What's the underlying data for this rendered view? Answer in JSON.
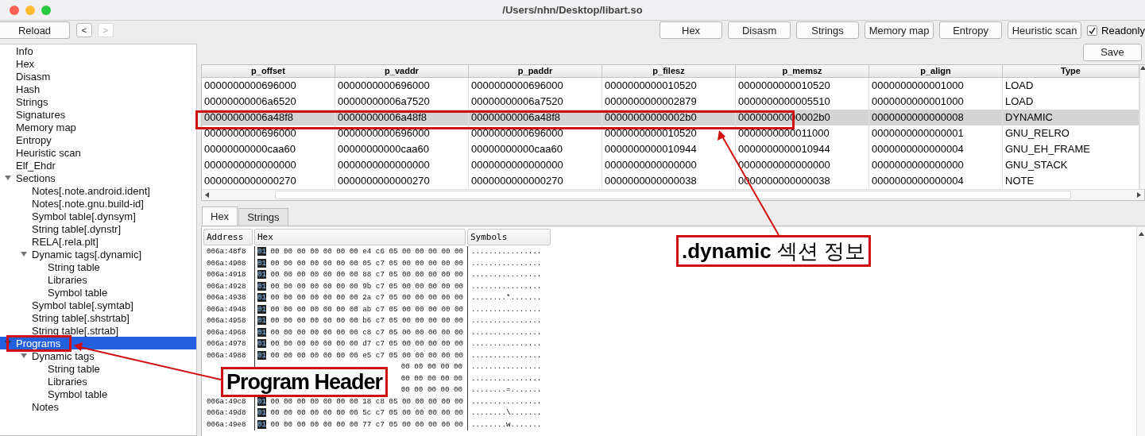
{
  "window": {
    "title": "/Users/nhn/Desktop/libart.so"
  },
  "toolbar": {
    "reload": "Reload",
    "nav": [
      {
        "label": "<",
        "disabled": false
      },
      {
        "label": ">",
        "disabled": true
      }
    ],
    "buttons": [
      "Hex",
      "Disasm",
      "Strings",
      "Memory map",
      "Entropy",
      "Heuristic scan"
    ],
    "readonly": {
      "label": "Readonly",
      "checked": true
    },
    "save": "Save"
  },
  "tree": [
    {
      "label": "Info",
      "selected": false
    },
    {
      "label": "Hex",
      "selected": false
    },
    {
      "label": "Disasm",
      "selected": false
    },
    {
      "label": "Hash",
      "selected": false
    },
    {
      "label": "Strings",
      "selected": false
    },
    {
      "label": "Signatures",
      "selected": false
    },
    {
      "label": "Memory map",
      "selected": false
    },
    {
      "label": "Entropy",
      "selected": false
    },
    {
      "label": "Heuristic scan",
      "selected": false
    },
    {
      "label": "Elf_Ehdr",
      "selected": false
    },
    {
      "label": "Sections",
      "selected": false,
      "expanded": true,
      "children": [
        {
          "label": "Notes[.note.android.ident]",
          "selected": false
        },
        {
          "label": "Notes[.note.gnu.build-id]",
          "selected": false
        },
        {
          "label": "Symbol table[.dynsym]",
          "selected": false
        },
        {
          "label": "String table[.dynstr]",
          "selected": false
        },
        {
          "label": "RELA[.rela.plt]",
          "selected": false
        },
        {
          "label": "Dynamic tags[.dynamic]",
          "selected": false,
          "expanded": true,
          "children": [
            {
              "label": "String table",
              "selected": false
            },
            {
              "label": "Libraries",
              "selected": false
            },
            {
              "label": "Symbol table",
              "selected": false
            }
          ]
        },
        {
          "label": "Symbol table[.symtab]",
          "selected": false
        },
        {
          "label": "String table[.shstrtab]",
          "selected": false
        },
        {
          "label": "String table[.strtab]",
          "selected": false
        }
      ]
    },
    {
      "label": "Programs",
      "selected": true,
      "expanded": true,
      "children": [
        {
          "label": "Dynamic tags",
          "selected": false,
          "expanded": true,
          "children": [
            {
              "label": "String table",
              "selected": false
            },
            {
              "label": "Libraries",
              "selected": false
            },
            {
              "label": "Symbol table",
              "selected": false
            }
          ]
        },
        {
          "label": "Notes",
          "selected": false
        }
      ]
    }
  ],
  "table": {
    "columns": [
      "p_offset",
      "p_vaddr",
      "p_paddr",
      "p_filesz",
      "p_memsz",
      "p_align",
      "Type"
    ],
    "rows": [
      {
        "selected": false,
        "cells": [
          "0000000000696000",
          "0000000000696000",
          "0000000000696000",
          "0000000000010520",
          "0000000000010520",
          "0000000000001000",
          "LOAD"
        ]
      },
      {
        "selected": false,
        "cells": [
          "00000000006a6520",
          "00000000006a7520",
          "00000000006a7520",
          "0000000000002879",
          "0000000000005510",
          "0000000000001000",
          "LOAD"
        ]
      },
      {
        "selected": true,
        "cells": [
          "00000000006a48f8",
          "00000000006a48f8",
          "00000000006a48f8",
          "00000000000002b0",
          "00000000000002b0",
          "0000000000000008",
          "DYNAMIC"
        ]
      },
      {
        "selected": false,
        "cells": [
          "0000000000696000",
          "0000000000696000",
          "0000000000696000",
          "0000000000010520",
          "0000000000011000",
          "0000000000000001",
          "GNU_RELRO"
        ]
      },
      {
        "selected": false,
        "cells": [
          "00000000000caa60",
          "00000000000caa60",
          "00000000000caa60",
          "0000000000010944",
          "0000000000010944",
          "0000000000000004",
          "GNU_EH_FRAME"
        ]
      },
      {
        "selected": false,
        "cells": [
          "0000000000000000",
          "0000000000000000",
          "0000000000000000",
          "0000000000000000",
          "0000000000000000",
          "0000000000000000",
          "GNU_STACK"
        ]
      },
      {
        "selected": false,
        "cells": [
          "0000000000000270",
          "0000000000000270",
          "0000000000000270",
          "0000000000000038",
          "0000000000000038",
          "0000000000000004",
          "NOTE"
        ]
      }
    ]
  },
  "tabs": [
    {
      "label": "Hex",
      "selected": true
    },
    {
      "label": "Strings",
      "selected": false
    }
  ],
  "hex": {
    "columns": [
      "Address",
      "Hex",
      "Symbols"
    ],
    "rows": [
      {
        "address": "006a:48f8",
        "first": "01",
        "hex": "00 00 00 00 00 00 00 e4 c6 05 00 00 00 00 00",
        "symbols": "................"
      },
      {
        "address": "006a:4908",
        "first": "01",
        "hex": "00 00 00 00 00 00 00 05 c7 05 00 00 00 00 00",
        "symbols": "................"
      },
      {
        "address": "006a:4918",
        "first": "01",
        "hex": "00 00 00 00 00 00 00 88 c7 05 00 00 00 00 00",
        "symbols": "................"
      },
      {
        "address": "006a:4928",
        "first": "01",
        "hex": "00 00 00 00 00 00 00 9b c7 05 00 00 00 00 00",
        "symbols": "................"
      },
      {
        "address": "006a:4938",
        "first": "01",
        "hex": "00 00 00 00 00 00 00 2a c7 05 00 00 00 00 00",
        "symbols": "........*......."
      },
      {
        "address": "006a:4948",
        "first": "01",
        "hex": "00 00 00 00 00 00 00 ab c7 05 00 00 00 00 00",
        "symbols": "................"
      },
      {
        "address": "006a:4958",
        "first": "01",
        "hex": "00 00 00 00 00 00 00 b6 c7 05 00 00 00 00 00",
        "symbols": "................"
      },
      {
        "address": "006a:4968",
        "first": "01",
        "hex": "00 00 00 00 00 00 00 c8 c7 05 00 00 00 00 00",
        "symbols": "................"
      },
      {
        "address": "006a:4978",
        "first": "01",
        "hex": "00 00 00 00 00 00 00 d7 c7 05 00 00 00 00 00",
        "symbols": "................"
      },
      {
        "address": "006a:4988",
        "first": "01",
        "hex": "00 00 00 00 00 00 00 e5 c7 05 00 00 00 00 00",
        "symbols": "................"
      },
      {
        "hex_tail": "00 00 00 00 00",
        "symbols": "................"
      },
      {
        "hex_tail": "00 00 00 00 00",
        "symbols": "................"
      },
      {
        "hex_tail": "00 00 00 00 00",
        "symbols": "........=......."
      },
      {
        "address": "006a:49c8",
        "first": "01",
        "hex": "00 00 00 00 00 00 00 18 c8 05 00 00 00 00 00",
        "symbols": "................"
      },
      {
        "address": "006a:49d8",
        "first": "01",
        "hex": "00 00 00 00 00 00 00 5c c7 05 00 00 00 00 00",
        "symbols": "........\\......."
      },
      {
        "address": "006a:49e8",
        "first": "01",
        "hex": "00 00 00 00 00 00 00 77 c7 05 00 00 00 00 00",
        "symbols": "........w......."
      }
    ]
  },
  "annotations": [
    {
      "kind": "callout",
      "text": "**.dynamic** 섹션 정보"
    },
    {
      "kind": "callout",
      "text": "Program Header"
    }
  ]
}
